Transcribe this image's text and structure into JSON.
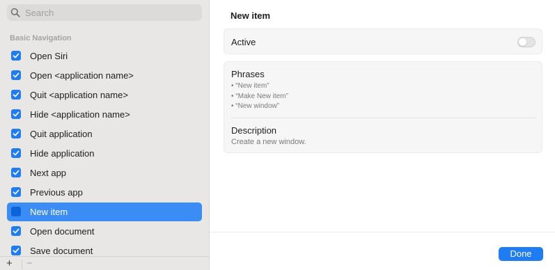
{
  "sidebar": {
    "search_placeholder": "Search",
    "section_title": "Basic Navigation",
    "items": [
      {
        "label": "Open Siri",
        "checked": true
      },
      {
        "label": "Open <application name>",
        "checked": true
      },
      {
        "label": "Quit <application name>",
        "checked": true
      },
      {
        "label": "Hide <application name>",
        "checked": true
      },
      {
        "label": "Quit application",
        "checked": true
      },
      {
        "label": "Hide application",
        "checked": true
      },
      {
        "label": "Next app",
        "checked": true
      },
      {
        "label": "Previous app",
        "checked": true
      },
      {
        "label": "New item",
        "checked": false,
        "selected": true
      },
      {
        "label": "Open document",
        "checked": true
      },
      {
        "label": "Save document",
        "checked": true
      }
    ],
    "add_label": "+",
    "remove_label": "−"
  },
  "detail": {
    "title": "New item",
    "active_label": "Active",
    "active_on": false,
    "phrases_label": "Phrases",
    "phrases": [
      "• “New item”",
      "• “Make New item”",
      "• “New window”"
    ],
    "description_label": "Description",
    "description_text": "Create a new window."
  },
  "footer": {
    "done_label": "Done"
  },
  "colors": {
    "accent": "#1f7cf2",
    "selection": "#3b8cf5",
    "sidebar_bg": "#e9e7e5"
  }
}
